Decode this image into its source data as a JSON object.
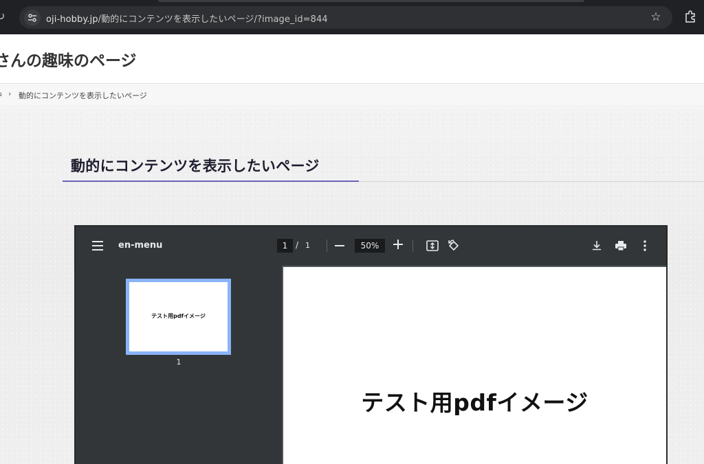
{
  "browser": {
    "url_host": "oji-hobby.jp",
    "url_path": "/動的にコンテンツを表示したいページ/?image_id=844",
    "reload_icon": "reload-icon",
    "site_info_icon": "tune-icon",
    "bookmark_icon": "star-icon",
    "extensions_icon": "puzzle-icon"
  },
  "site": {
    "title": "さんの趣味のページ"
  },
  "breadcrumb": {
    "home_icon": "home-icon",
    "separator": "›",
    "current": "動的にコンテンツを表示したいページ"
  },
  "main": {
    "heading": "動的にコンテンツを表示したいページ",
    "accent_color": "#6a63b8"
  },
  "pdf_viewer": {
    "doc_title": "en-menu",
    "current_page": "1",
    "page_separator": "/",
    "total_pages": "1",
    "zoom": "50%",
    "thumbnails": [
      {
        "text": "テスト用pdfイメージ",
        "number": "1"
      }
    ],
    "page_text": "テスト用pdfイメージ",
    "thumb_border_color": "#8ab4f8"
  }
}
